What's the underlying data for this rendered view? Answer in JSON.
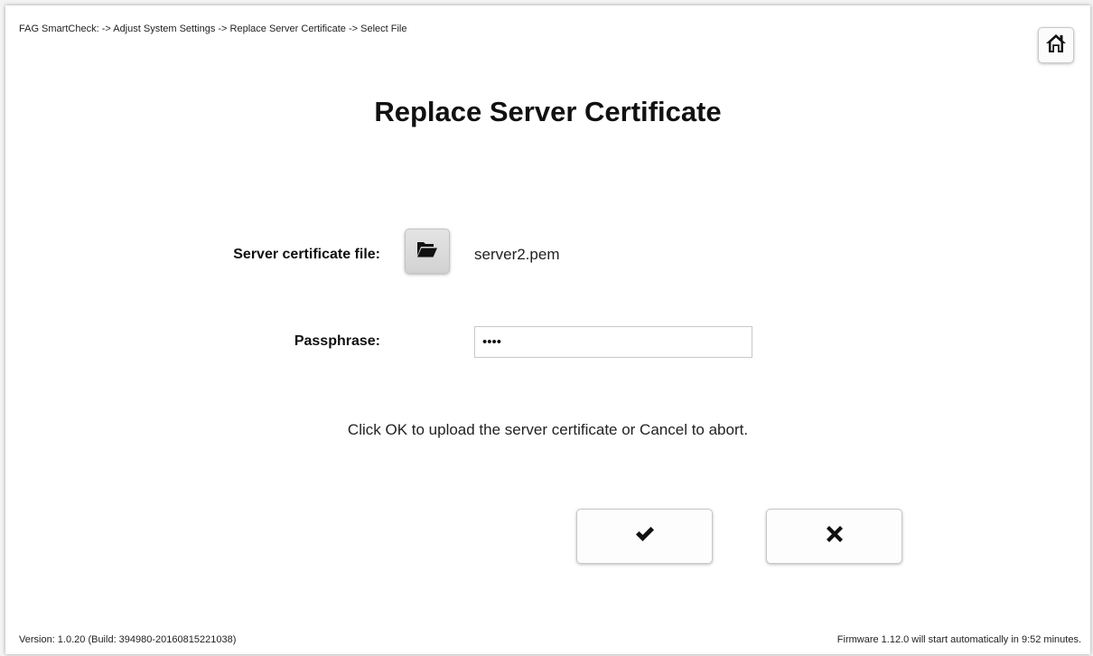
{
  "breadcrumb": "FAG SmartCheck: -> Adjust System Settings -> Replace Server Certificate -> Select File",
  "header": {
    "home_icon": "home-icon"
  },
  "title": "Replace Server Certificate",
  "form": {
    "file_label": "Server certificate file:",
    "file_button_icon": "folder-open-icon",
    "file_name": "server2.pem",
    "passphrase_label": "Passphrase:",
    "passphrase_value": "1234"
  },
  "instruction": "Click OK to upload the server certificate or Cancel to abort.",
  "actions": {
    "ok_icon": "checkmark-icon",
    "cancel_icon": "x-icon"
  },
  "footer": {
    "version": "Version: 1.0.20 (Build: 394980-20160815221038)",
    "firmware_notice": "Firmware 1.12.0 will start automatically in 9:52 minutes."
  },
  "colors": {
    "background": "#ffffff",
    "text": "#111111",
    "button_border": "#c8c8c8"
  }
}
